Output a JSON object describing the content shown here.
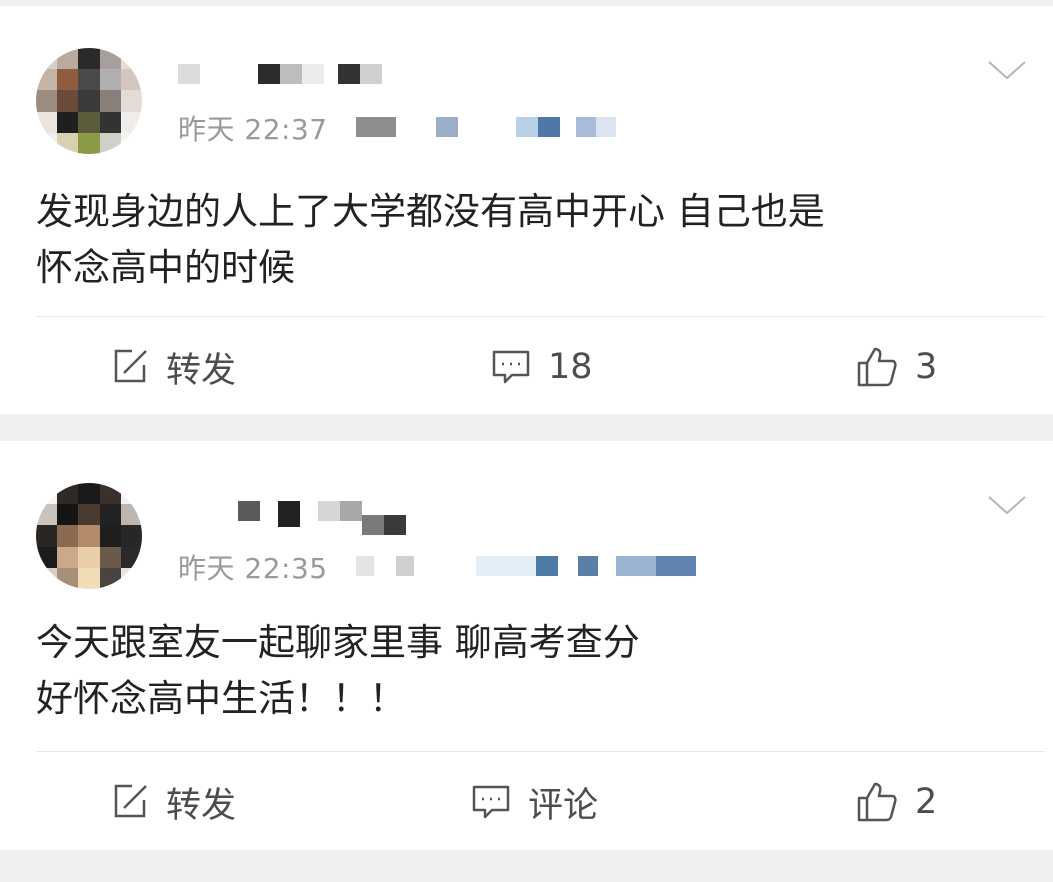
{
  "posts": [
    {
      "time": "昨天 22:37",
      "content": [
        "发现身边的人上了大学都没有高中开心 自己也是",
        "怀念高中的时候"
      ],
      "actions": {
        "repost": "转发",
        "comment": "18",
        "like": "3"
      }
    },
    {
      "time": "昨天 22:35",
      "content": [
        "今天跟室友一起聊家里事 聊高考查分",
        "好怀念高中生活！！！"
      ],
      "actions": {
        "repost": "转发",
        "comment": "评论",
        "like": "2"
      }
    }
  ],
  "icons": {
    "repost": "repost-icon",
    "comment": "comment-icon",
    "like": "thumbs-up-icon",
    "more": "chevron-down-icon"
  },
  "colors": {
    "background": "#efefef",
    "card": "#ffffff",
    "text": "#222222",
    "meta": "#9a9a9a",
    "action": "#4d4d4d"
  }
}
